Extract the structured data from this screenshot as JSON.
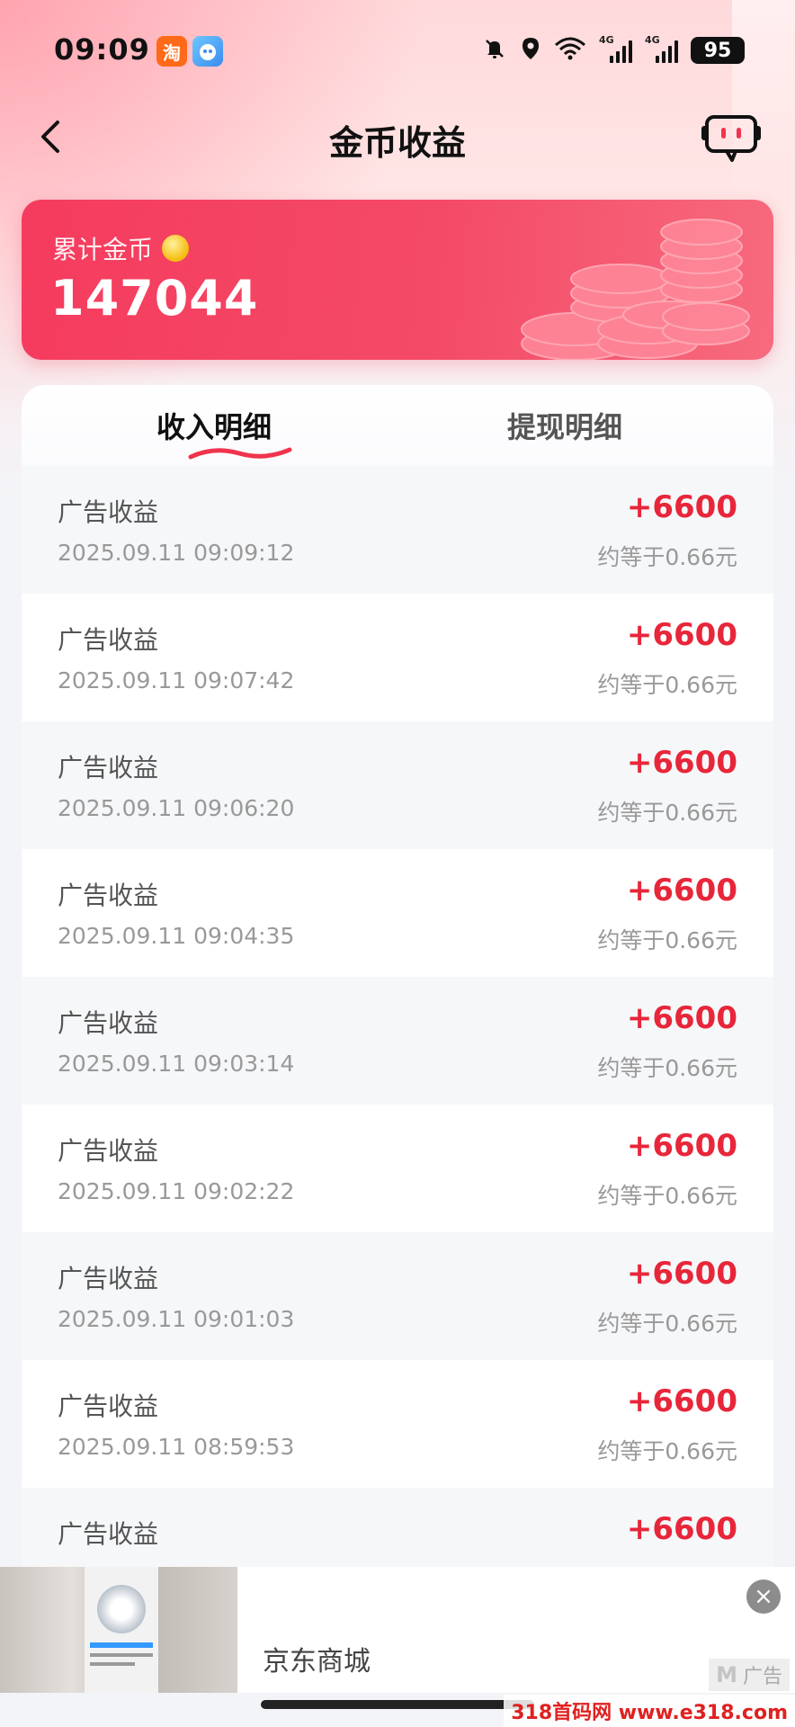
{
  "status_bar": {
    "time": "09:09",
    "apps": [
      {
        "icon": "taobao-icon",
        "glyph": "淘"
      },
      {
        "icon": "app-mascot-icon",
        "glyph": ""
      }
    ],
    "network": "4G",
    "battery": "95"
  },
  "nav": {
    "title": "金币收益",
    "back_icon": "chevron-left-icon",
    "service_icon": "customer-service-icon"
  },
  "coin_card": {
    "label": "累计金币",
    "total": "147044"
  },
  "tabs": [
    {
      "label": "收入明细",
      "active": true
    },
    {
      "label": "提现明细",
      "active": false
    }
  ],
  "records": [
    {
      "title": "广告收益",
      "time": "2025.09.11 09:09:12",
      "amount": "+6600",
      "approx": "约等于0.66元"
    },
    {
      "title": "广告收益",
      "time": "2025.09.11 09:07:42",
      "amount": "+6600",
      "approx": "约等于0.66元"
    },
    {
      "title": "广告收益",
      "time": "2025.09.11 09:06:20",
      "amount": "+6600",
      "approx": "约等于0.66元"
    },
    {
      "title": "广告收益",
      "time": "2025.09.11 09:04:35",
      "amount": "+6600",
      "approx": "约等于0.66元"
    },
    {
      "title": "广告收益",
      "time": "2025.09.11 09:03:14",
      "amount": "+6600",
      "approx": "约等于0.66元"
    },
    {
      "title": "广告收益",
      "time": "2025.09.11 09:02:22",
      "amount": "+6600",
      "approx": "约等于0.66元"
    },
    {
      "title": "广告收益",
      "time": "2025.09.11 09:01:03",
      "amount": "+6600",
      "approx": "约等于0.66元"
    },
    {
      "title": "广告收益",
      "time": "2025.09.11 08:59:53",
      "amount": "+6600",
      "approx": "约等于0.66元"
    },
    {
      "title": "广告收益",
      "time": "",
      "amount": "+6600",
      "approx": ""
    }
  ],
  "ad": {
    "name": "京东商城",
    "mark": "广告",
    "close": "×"
  },
  "watermark": "318首码网 www.e318.com",
  "colors": {
    "accent_red": "#e8263a",
    "card_red": "#f53b5e",
    "coin_gold": "#f7c21c"
  }
}
